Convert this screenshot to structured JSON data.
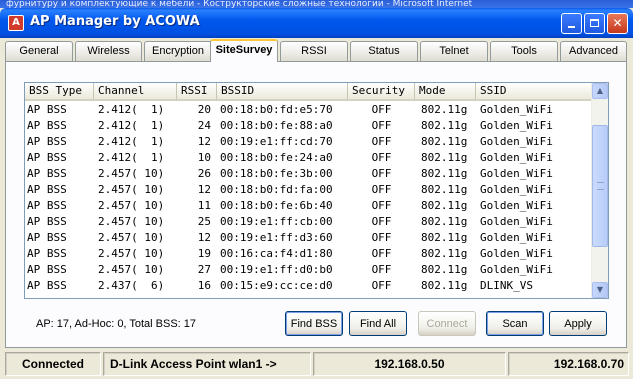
{
  "background_window": {
    "title": "фурнитуру и комплектующие к мебели - Кострукторские сложные технологии - Microsoft Internet"
  },
  "window": {
    "title": "AP Manager by ACOWA",
    "icon": "acowa-app-icon"
  },
  "tabs": [
    "General",
    "Wireless",
    "Encryption",
    "SiteSurvey",
    "RSSI",
    "Status",
    "Telnet",
    "Tools",
    "Advanced"
  ],
  "active_tab": "SiteSurvey",
  "table": {
    "columns": [
      "BSS Type",
      "Channel",
      "RSSI",
      "BSSID",
      "Security",
      "Mode",
      "SSID"
    ],
    "rows": [
      [
        "AP BSS",
        "2.412(  1)",
        "20",
        "00:18:b0:fd:e5:70",
        "OFF",
        "802.11g",
        "Golden_WiFi"
      ],
      [
        "AP BSS",
        "2.412(  1)",
        "24",
        "00:18:b0:fe:88:a0",
        "OFF",
        "802.11g",
        "Golden_WiFi"
      ],
      [
        "AP BSS",
        "2.412(  1)",
        "12",
        "00:19:e1:ff:cd:70",
        "OFF",
        "802.11g",
        "Golden_WiFi"
      ],
      [
        "AP BSS",
        "2.412(  1)",
        "10",
        "00:18:b0:fe:24:a0",
        "OFF",
        "802.11g",
        "Golden_WiFi"
      ],
      [
        "AP BSS",
        "2.457( 10)",
        "26",
        "00:18:b0:fe:3b:00",
        "OFF",
        "802.11g",
        "Golden_WiFi"
      ],
      [
        "AP BSS",
        "2.457( 10)",
        "12",
        "00:18:b0:fd:fa:00",
        "OFF",
        "802.11g",
        "Golden_WiFi"
      ],
      [
        "AP BSS",
        "2.457( 10)",
        "11",
        "00:18:b0:fe:6b:40",
        "OFF",
        "802.11g",
        "Golden_WiFi"
      ],
      [
        "AP BSS",
        "2.457( 10)",
        "25",
        "00:19:e1:ff:cb:00",
        "OFF",
        "802.11g",
        "Golden_WiFi"
      ],
      [
        "AP BSS",
        "2.457( 10)",
        "12",
        "00:19:e1:ff:d3:60",
        "OFF",
        "802.11g",
        "Golden_WiFi"
      ],
      [
        "AP BSS",
        "2.457( 10)",
        "19",
        "00:16:ca:f4:d1:80",
        "OFF",
        "802.11g",
        "Golden_WiFi"
      ],
      [
        "AP BSS",
        "2.457( 10)",
        "27",
        "00:19:e1:ff:d0:b0",
        "OFF",
        "802.11g",
        "Golden_WiFi"
      ],
      [
        "AP BSS",
        "2.437(  6)",
        "16",
        "00:15:e9:cc:ce:d0",
        "OFF",
        "802.11g",
        "DLINK_VS"
      ]
    ]
  },
  "summary": "AP: 17, Ad-Hoc: 0, Total BSS: 17",
  "buttons": {
    "find_bss": "Find BSS",
    "find_all": "Find All",
    "connect": "Connect",
    "scan": "Scan",
    "apply": "Apply"
  },
  "statusbar": {
    "connection": "Connected",
    "device": "D-Link Access Point wlan1 ->",
    "local_ip": "192.168.0.50",
    "remote_ip": "192.168.0.70"
  },
  "colors": {
    "titlebar": "#0054e3",
    "active_tab_accent": "#ffc83c",
    "list_border": "#7f9db9"
  }
}
